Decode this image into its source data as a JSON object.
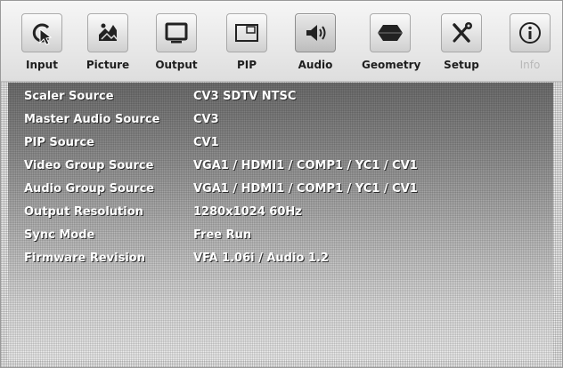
{
  "toolbar": {
    "items": [
      {
        "label": "Input",
        "icon": "input-cursor-icon"
      },
      {
        "label": "Picture",
        "icon": "picture-icon"
      },
      {
        "label": "Output",
        "icon": "monitor-icon"
      },
      {
        "label": "PIP",
        "icon": "pip-icon"
      },
      {
        "label": "Audio",
        "icon": "speaker-icon"
      },
      {
        "label": "Geometry",
        "icon": "geometry-icon"
      },
      {
        "label": "Setup",
        "icon": "tools-icon"
      },
      {
        "label": "Info",
        "icon": "info-icon"
      }
    ]
  },
  "status": {
    "rows": [
      {
        "key": "Scaler Source",
        "value": "CV3 SDTV NTSC"
      },
      {
        "key": "Master Audio Source",
        "value": "CV3"
      },
      {
        "key": "PIP Source",
        "value": "CV1"
      },
      {
        "key": "Video Group Source",
        "value": "VGA1 / HDMI1 / COMP1 / YC1 / CV1"
      },
      {
        "key": "Audio Group Source",
        "value": "VGA1 / HDMI1 / COMP1 / YC1 / CV1"
      },
      {
        "key": "Output Resolution",
        "value": "1280x1024 60Hz"
      },
      {
        "key": "Sync Mode",
        "value": "Free Run"
      },
      {
        "key": "Firmware Revision",
        "value": "VFA 1.06i / Audio 1.2"
      }
    ]
  }
}
